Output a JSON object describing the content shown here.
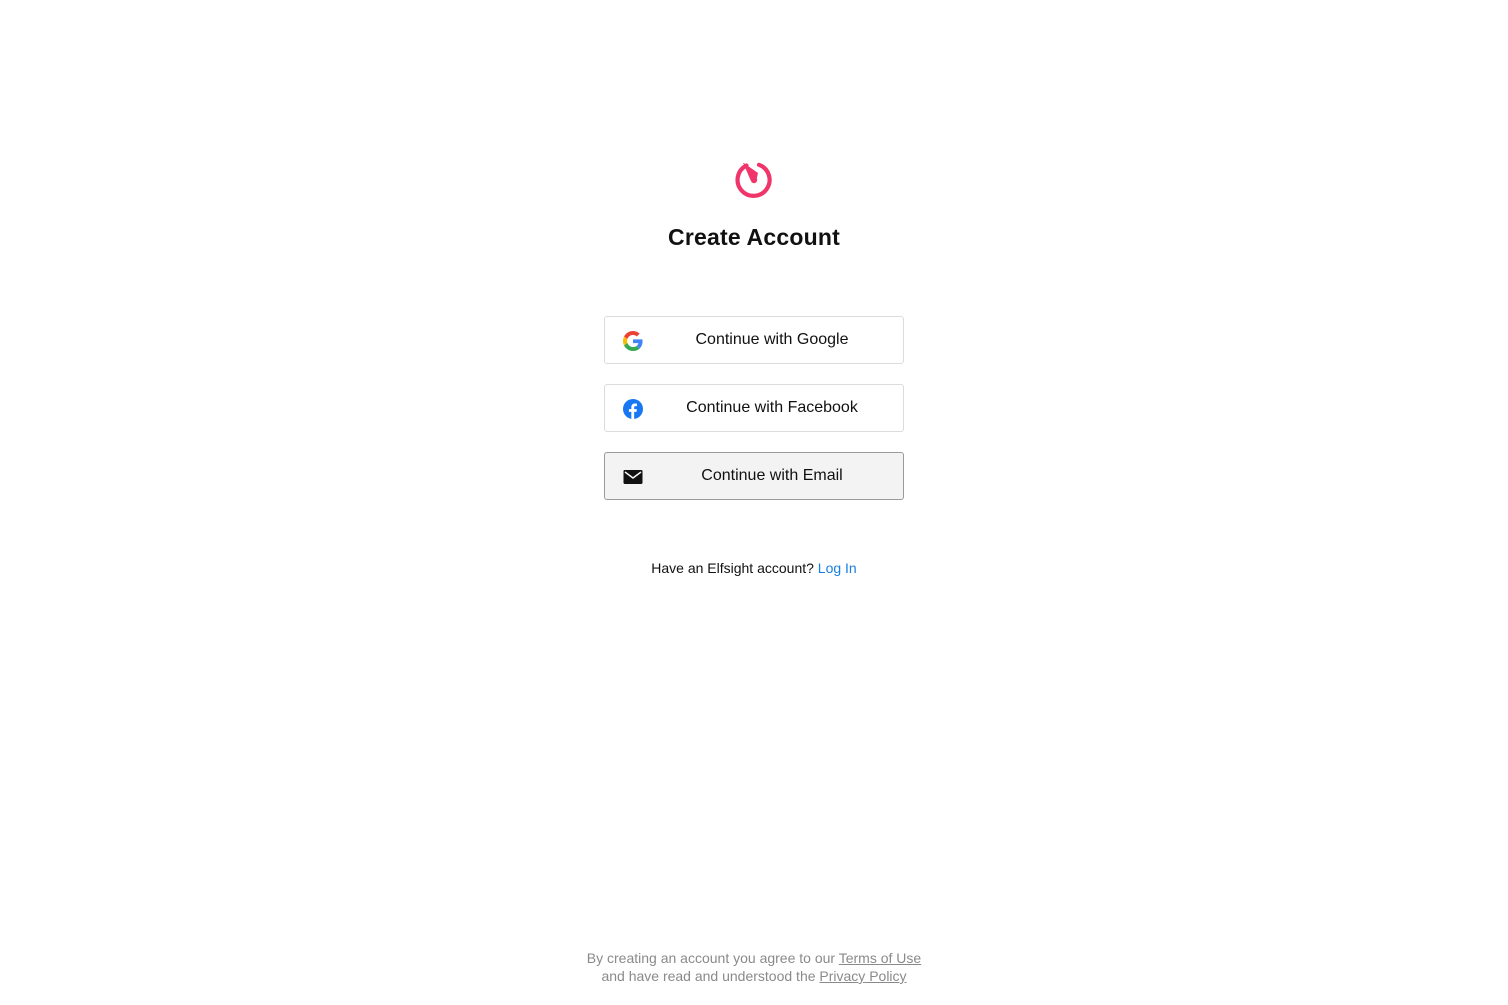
{
  "brand": {
    "logo_icon": "elfsight-logo-icon",
    "accent_color": "#f0356b"
  },
  "page": {
    "title": "Create Account"
  },
  "auth_buttons": {
    "google": {
      "label": "Continue with Google",
      "icon": "google-icon"
    },
    "facebook": {
      "label": "Continue with Facebook",
      "icon": "facebook-icon",
      "color": "#1877f2"
    },
    "email": {
      "label": "Continue with Email",
      "icon": "envelope-icon"
    }
  },
  "login": {
    "prompt": "Have an Elfsight account?",
    "link_label": "Log In",
    "link_color": "#1a7fe0"
  },
  "legal": {
    "line1_prefix": "By creating an account you agree to our",
    "terms_label": "Terms of Use",
    "line2_prefix": "and have read and understood the",
    "privacy_label": "Privacy Policy"
  }
}
